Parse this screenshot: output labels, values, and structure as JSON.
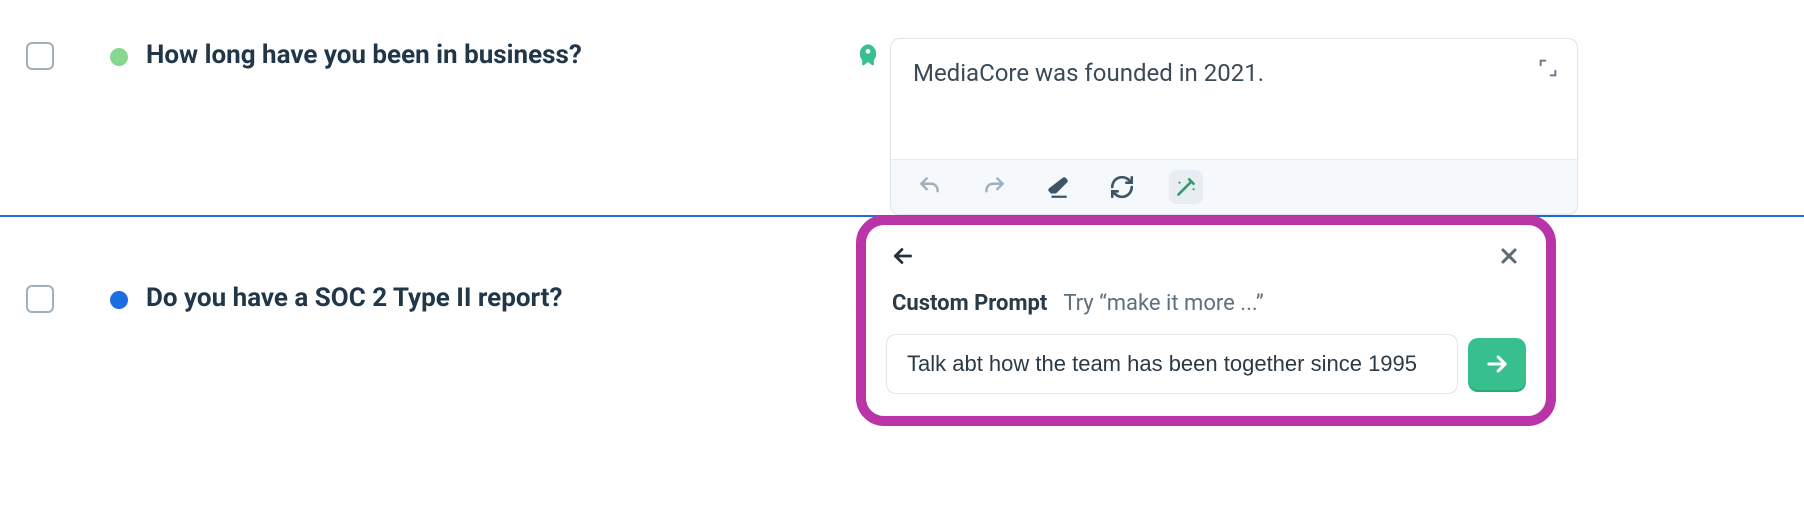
{
  "rows": [
    {
      "question": "How long have you been in business?",
      "status_color": "#86d890",
      "answer": "MediaCore was founded in 2021."
    },
    {
      "question": "Do you have a SOC 2 Type II report?",
      "status_color": "#1b6ee2"
    }
  ],
  "prompt_panel": {
    "title": "Custom Prompt",
    "hint": "Try “make it more ...”",
    "input_value": "Talk abt how the team has been together since 1995"
  }
}
